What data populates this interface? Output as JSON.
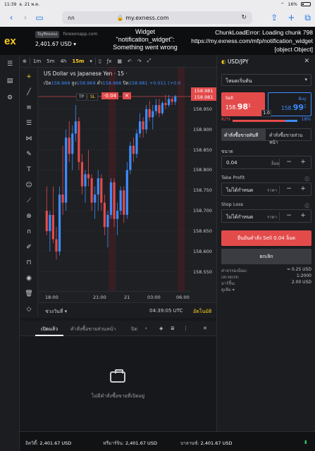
{
  "status_bar": {
    "time": "11:39",
    "date": "อ. 21 พ.ค.",
    "battery": "16%"
  },
  "safari": {
    "aa": "กก",
    "url": "my.exness.com"
  },
  "header": {
    "logo": "ex",
    "account_type": "ปัญชีทดลอง",
    "site": "forexonapp.com",
    "balance": "2,401.67 USD",
    "error_widget": "Widget \"notification_widget\": Something went wrong",
    "chunk_error": [
      "ChunkLoadError: Loading chunk 798",
      "https://my.exness.com/mfp/notification_widget",
      "[object Object]"
    ]
  },
  "chart_toolbar": {
    "timeframes": [
      "1m",
      "5m",
      "4h",
      "15m"
    ],
    "active": "15m",
    "indicator": "ƒx"
  },
  "chart": {
    "title": "US Dollar vs Japanese Yen · 15 ·",
    "ohlc": {
      "o_label": "เปิด",
      "o": "158.969",
      "h_label": "สูง",
      "h": "158.969",
      "l_label": "ต่ำ",
      "l": "158.968",
      "c_label": "ปิด",
      "c": "158.981",
      "chg": "+0.011 (+0.0"
    },
    "tp_label": "TP",
    "sl_label": "SL",
    "pnl": "-0.04",
    "current_price": "158.981",
    "ask_price": "158.981",
    "y_ticks": [
      "158.950",
      "158.900",
      "158.850",
      "158.800",
      "158.750",
      "158.700",
      "158.650",
      "158.600",
      "158.550"
    ],
    "x_ticks": [
      "18:00",
      "21:00",
      "21",
      "03:00",
      "06:00"
    ],
    "period_label": "ช่วงวันที่",
    "clock": "04:39:05 UTC",
    "auto_label": "อัตโนมัติ"
  },
  "chart_data": {
    "type": "candlestick",
    "ylim": [
      158.52,
      159.0
    ],
    "candles": [
      [
        158.7,
        158.76,
        158.64,
        158.65
      ],
      [
        158.65,
        158.7,
        158.6,
        158.69
      ],
      [
        158.69,
        158.76,
        158.62,
        158.63
      ],
      [
        158.63,
        158.66,
        158.58,
        158.6
      ],
      [
        158.6,
        158.76,
        158.59,
        158.74
      ],
      [
        158.74,
        158.86,
        158.69,
        158.72
      ],
      [
        158.72,
        158.9,
        158.7,
        158.88
      ],
      [
        158.88,
        158.92,
        158.82,
        158.84
      ],
      [
        158.84,
        158.91,
        158.8,
        158.89
      ],
      [
        158.89,
        158.96,
        158.87,
        158.92
      ],
      [
        158.92,
        158.93,
        158.8,
        158.82
      ],
      [
        158.82,
        158.84,
        158.74,
        158.76
      ],
      [
        158.76,
        158.8,
        158.72,
        158.79
      ],
      [
        158.79,
        158.85,
        158.76,
        158.78
      ],
      [
        158.78,
        158.79,
        158.7,
        158.72
      ],
      [
        158.72,
        158.76,
        158.68,
        158.74
      ],
      [
        158.74,
        158.8,
        158.7,
        158.78
      ],
      [
        158.78,
        158.79,
        158.7,
        158.72
      ],
      [
        158.72,
        158.74,
        158.64,
        158.66
      ],
      [
        158.66,
        158.7,
        158.61,
        158.69
      ],
      [
        158.69,
        158.78,
        158.68,
        158.77
      ],
      [
        158.77,
        158.78,
        158.66,
        158.68
      ],
      [
        158.68,
        158.72,
        158.64,
        158.7
      ],
      [
        158.7,
        158.76,
        158.69,
        158.75
      ],
      [
        158.75,
        158.76,
        158.67,
        158.69
      ],
      [
        158.69,
        158.82,
        158.68,
        158.8
      ],
      [
        158.8,
        158.87,
        158.79,
        158.86
      ],
      [
        158.86,
        158.88,
        158.82,
        158.84
      ],
      [
        158.84,
        158.9,
        158.83,
        158.89
      ],
      [
        158.89,
        158.94,
        158.88,
        158.92
      ],
      [
        158.92,
        158.93,
        158.88,
        158.9
      ],
      [
        158.9,
        158.96,
        158.89,
        158.95
      ],
      [
        158.95,
        158.97,
        158.92,
        158.93
      ],
      [
        158.93,
        158.96,
        158.9,
        158.945
      ],
      [
        158.945,
        158.975,
        158.935,
        158.96
      ],
      [
        158.96,
        158.975,
        158.93,
        158.94
      ],
      [
        158.94,
        158.97,
        158.935,
        158.965
      ],
      [
        158.965,
        158.985,
        158.95,
        158.96
      ],
      [
        158.96,
        158.985,
        158.955,
        158.975
      ],
      [
        158.975,
        158.98,
        158.96,
        158.968
      ],
      [
        158.968,
        158.985,
        158.96,
        158.981
      ]
    ],
    "up_color": "#3f8cff",
    "down_color": "#e34b4b"
  },
  "positions": {
    "tabs": [
      "เปิดแล้ว",
      "คำสั่งซื้อขายส่วนหน้า",
      "ปิด"
    ],
    "empty_text": "ไม่มีคำสั่งซื้อขายที่เปิดอยู่"
  },
  "footer": {
    "equity_label": "อิควิตี้:",
    "equity": "2,401.67 USD",
    "free_margin_label": "ฟรีมาร์จิน:",
    "free_margin": "2,401.67 USD",
    "balance_label": "บาลานซ์:",
    "balance": "2,401.67 USD"
  },
  "order": {
    "symbol": "USD/JPY",
    "mode": "โหมดเริ่มต้น",
    "sell_label": "Sell",
    "sell_price_main": "158.",
    "sell_price_big": "98",
    "sell_price_sup": "1",
    "buy_label": "Buy",
    "buy_price_main": "158.",
    "buy_price_big": "99",
    "buy_price_sup": "1",
    "spread": "1.0",
    "sent_sell": "82%",
    "sent_buy": "18%",
    "type_market": "คำสั่งซื้อขายทันที",
    "type_pending": "คำสั่งซื้อขายส่วนหน้า",
    "volume_label": "ขนาด",
    "volume": "0.04",
    "volume_unit": "ล็อต",
    "tp_label": "Take Profit",
    "tp_value": "ไม่ได้กำหนด",
    "tp_unit": "ราคา",
    "sl_label": "Stop Loss",
    "sl_value": "ไม่ได้กำหนด",
    "sl_unit": "ราคา",
    "confirm": "ยืนยันคำสั่ง Sell 0.04 ล็อต",
    "cancel": "ยกเลิก",
    "fee_label": "ค่าธรรมเนียม:",
    "fee": "≈ 0.25 USD",
    "leverage_label": "เลเวอเรจ:",
    "leverage": "1:2000",
    "margin_label": "มาร์จิ้น:",
    "margin": "2.00 USD",
    "more_label": "ดูเพิ่ม"
  }
}
